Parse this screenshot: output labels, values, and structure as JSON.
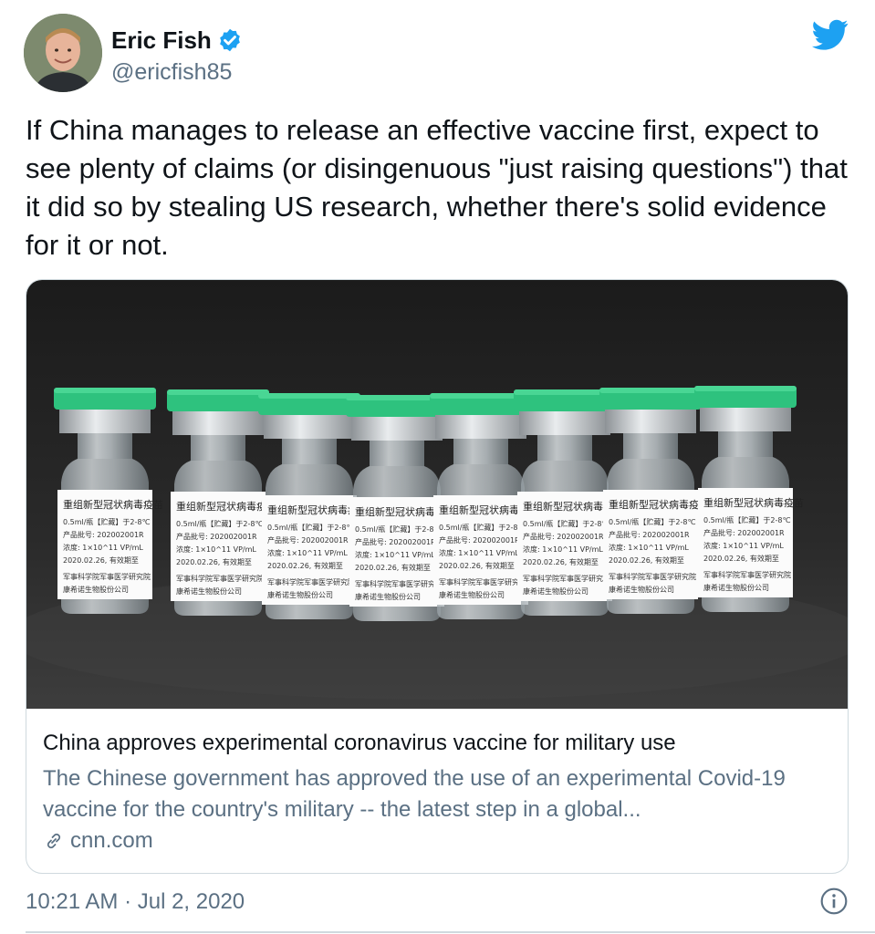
{
  "author": {
    "name": "Eric Fish",
    "handle": "@ericfish85",
    "verified": true,
    "avatar_icon": "person-avatar"
  },
  "brand": {
    "icon": "twitter-bird-icon",
    "color": "#1da1f2"
  },
  "tweet": {
    "text": "If China manages to release an effective vaccine first, expect to see plenty of claims (or disingenuous \"just raising questions\") that it did so by stealing US research, whether there's solid evidence for it or not."
  },
  "card": {
    "image_icon": "vaccine-vials-photo",
    "title": "China approves experimental coronavirus vaccine for military use",
    "description": "The Chinese government has approved the use of an experimental Covid-19 vaccine for the country's military -- the latest step in a global...",
    "domain": "cnn.com",
    "link_icon": "link-icon",
    "vial_label": {
      "title": "重组新型冠状病毒疫苗",
      "batch": "产品批号: 202002001R",
      "date": "2020.02.26",
      "maker": "军事科学院军事医学研究院"
    }
  },
  "meta": {
    "timestamp": "10:21 AM · Jul 2, 2020",
    "info_icon": "info-icon"
  },
  "colors": {
    "text": "#0f1419",
    "secondary": "#5b7083",
    "border": "#cfd9de",
    "accent": "#1da1f2",
    "cap": "#2ec27e"
  }
}
